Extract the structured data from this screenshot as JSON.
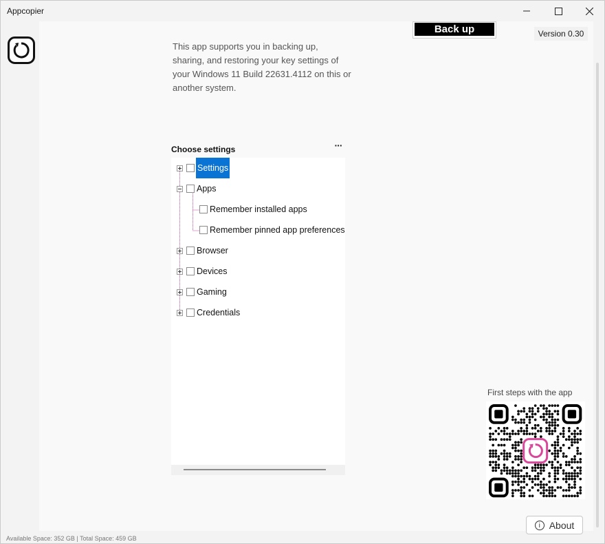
{
  "window": {
    "title": "Appcopier"
  },
  "header": {
    "backup_label": "Back up",
    "version": "Version 0.30"
  },
  "intro": {
    "text": "This app supports you in backing up, sharing, and restoring your key settings of your Windows 11 Build 22631.4112 on this or another system."
  },
  "settings_panel": {
    "heading": "Choose settings",
    "more_label": "···",
    "tree": [
      {
        "label": "Settings",
        "expanded": false,
        "selected": true,
        "checked": false
      },
      {
        "label": "Apps",
        "expanded": true,
        "selected": false,
        "checked": false,
        "children": [
          {
            "label": "Remember installed apps",
            "checked": false
          },
          {
            "label": "Remember pinned app preferences",
            "checked": false
          }
        ]
      },
      {
        "label": "Browser",
        "expanded": false,
        "checked": false
      },
      {
        "label": "Devices",
        "expanded": false,
        "checked": false
      },
      {
        "label": "Gaming",
        "expanded": false,
        "checked": false
      },
      {
        "label": "Credentials",
        "expanded": false,
        "checked": false
      }
    ]
  },
  "help": {
    "first_steps_label": "First steps with the app"
  },
  "footer": {
    "about_label": "About",
    "status_text": "Available Space: 352 GB | Total Space: 459 GB"
  },
  "colors": {
    "selection": "#0a74d4",
    "qr_accent": "#d9479a",
    "primary_button": "#000000"
  },
  "icons": {
    "app_logo": "restore-circle-icon",
    "about": "info-icon",
    "qr_center": "restore-circle-icon"
  }
}
